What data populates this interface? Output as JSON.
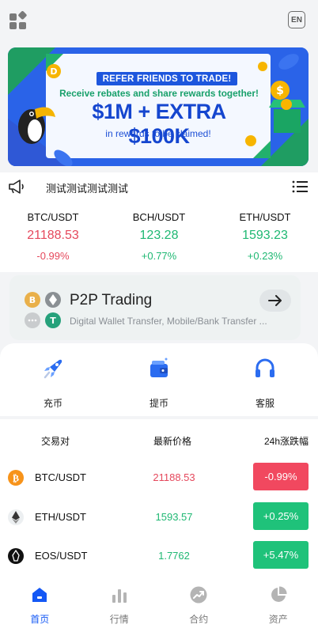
{
  "header": {
    "apps_icon": "apps-grid-icon",
    "lang_label": "EN"
  },
  "banner": {
    "pill": "REFER FRIENDS TO TRADE!",
    "subtitle": "Receive rebates and share rewards together!",
    "headline": "$1M + EXTRA $100K",
    "footnote": "in rewards to be claimed!",
    "colors": {
      "background": "#2a63e8",
      "headline": "#1546cf",
      "subtitle": "#18a06a"
    }
  },
  "notice": {
    "icon": "megaphone-icon",
    "text": "测试测试测试测试",
    "menu_icon": "list-menu-icon"
  },
  "tickers": [
    {
      "pair": "BTC/USDT",
      "price": "21188.53",
      "change": "-0.99%",
      "trend": "down"
    },
    {
      "pair": "BCH/USDT",
      "price": "123.28",
      "change": "+0.77%",
      "trend": "up"
    },
    {
      "pair": "ETH/USDT",
      "price": "1593.23",
      "change": "+0.23%",
      "trend": "up"
    }
  ],
  "p2p": {
    "title": "P2P Trading",
    "description": "Digital Wallet Transfer, Mobile/Bank Transfer ...",
    "arrow_icon": "arrow-right-icon"
  },
  "quick_actions": [
    {
      "label": "充币",
      "icon": "rocket-icon"
    },
    {
      "label": "提币",
      "icon": "wallet-icon"
    },
    {
      "label": "客服",
      "icon": "headset-icon"
    }
  ],
  "market": {
    "headers": {
      "pair": "交易对",
      "price": "最新价格",
      "change": "24h涨跌幅"
    },
    "rows": [
      {
        "pair": "BTC/USDT",
        "price": "21188.53",
        "change": "-0.99%",
        "trend": "down",
        "icon": "bitcoin-icon"
      },
      {
        "pair": "ETH/USDT",
        "price": "1593.57",
        "change": "+0.25%",
        "trend": "up",
        "icon": "ethereum-icon"
      },
      {
        "pair": "EOS/USDT",
        "price": "1.7762",
        "change": "+5.47%",
        "trend": "up",
        "icon": "eos-icon"
      }
    ]
  },
  "tabs": [
    {
      "label": "首页",
      "icon": "home-icon",
      "active": true
    },
    {
      "label": "行情",
      "icon": "bar-chart-icon",
      "active": false
    },
    {
      "label": "合约",
      "icon": "trend-up-icon",
      "active": false
    },
    {
      "label": "资产",
      "icon": "pie-chart-icon",
      "active": false
    }
  ],
  "colors": {
    "up": "#1fc27a",
    "down": "#f1485f",
    "accent": "#1458f5"
  }
}
